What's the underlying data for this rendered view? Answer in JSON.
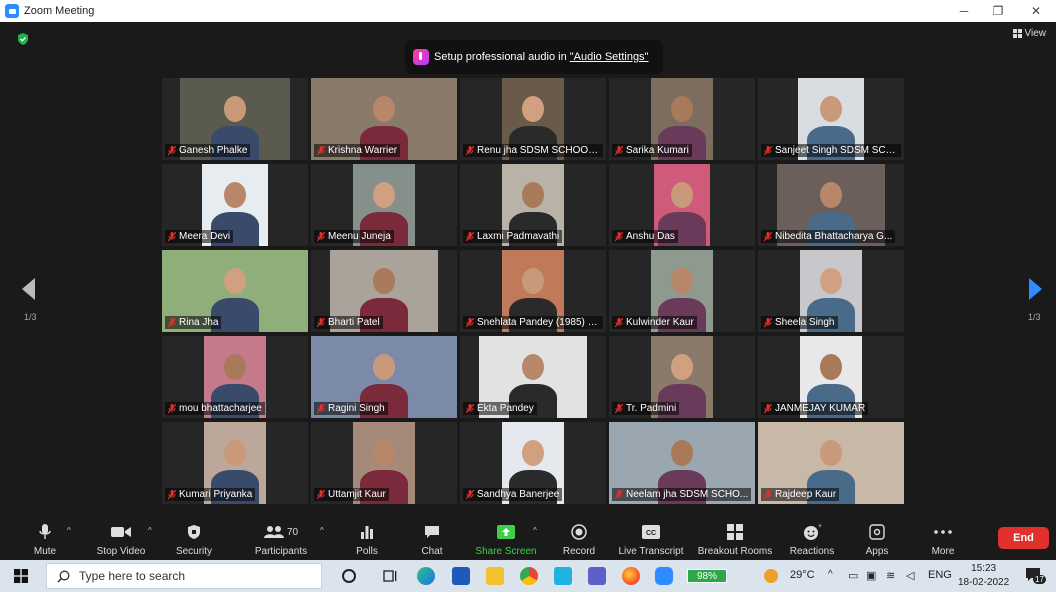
{
  "window": {
    "title": "Zoom Meeting",
    "minimize": "─",
    "restore": "❐",
    "close": "✕"
  },
  "meeting": {
    "view_label": "View",
    "notice": {
      "text": "Setup professional audio in",
      "link": "\"Audio Settings\""
    },
    "page_left": "1/3",
    "page_right": "1/3",
    "participants": [
      {
        "name": "Ganesh Phalke"
      },
      {
        "name": "Krishna Warrier"
      },
      {
        "name": "Renu jha SDSM SCHOOL ..."
      },
      {
        "name": "Sarika Kumari"
      },
      {
        "name": "Sanjeet Singh SDSM SCH..."
      },
      {
        "name": "Meera Devi"
      },
      {
        "name": "Meenu Juneja"
      },
      {
        "name": "Laxmi Padmavathi"
      },
      {
        "name": "Anshu Das"
      },
      {
        "name": "Nibedita Bhattacharya G..."
      },
      {
        "name": "Rina Jha"
      },
      {
        "name": "Bharti Patel"
      },
      {
        "name": "Snehlata Pandey (1985) B..."
      },
      {
        "name": "Kulwinder Kaur"
      },
      {
        "name": "Sheela Singh"
      },
      {
        "name": "mou bhattacharjee"
      },
      {
        "name": "Ragini Singh"
      },
      {
        "name": "Ekta Pandey"
      },
      {
        "name": "Tr. Padmini"
      },
      {
        "name": "JANMEJAY KUMAR"
      },
      {
        "name": "Kumari Priyanka"
      },
      {
        "name": "Uttamjit Kaur"
      },
      {
        "name": "Sandhya Banerjee"
      },
      {
        "name": "Neelam jha SDSM SCHO..."
      },
      {
        "name": "Rajdeep Kaur"
      }
    ]
  },
  "toolbar": {
    "mute": "Mute",
    "stop_video": "Stop Video",
    "security": "Security",
    "participants": "Participants",
    "participants_count": "70",
    "polls": "Polls",
    "chat": "Chat",
    "share_screen": "Share Screen",
    "record": "Record",
    "live_transcript": "Live Transcript",
    "breakout_rooms": "Breakout Rooms",
    "reactions": "Reactions",
    "apps": "Apps",
    "more": "More",
    "end": "End"
  },
  "taskbar": {
    "search_placeholder": "Type here to search",
    "battery": "98%",
    "temperature": "29°C",
    "language": "ENG",
    "time": "15:23",
    "date": "18-02-2022",
    "notifications": "17"
  }
}
